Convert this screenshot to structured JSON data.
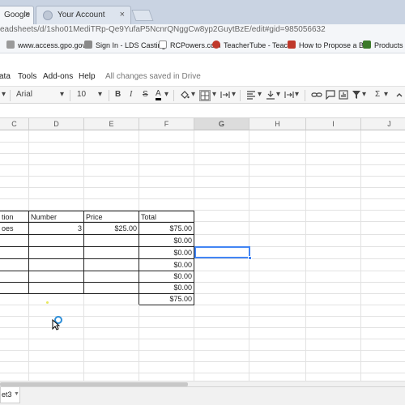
{
  "browser": {
    "tabs": [
      {
        "title": "Google",
        "close": "×"
      },
      {
        "title": "Your Account",
        "close": "×"
      }
    ],
    "url": "eadsheets/d/1sho01MediTRp-Qe9YufaP5NcnrQNggCw8yp2GuytBzE/edit#gid=985056632",
    "bookmarks": [
      {
        "label": "www.access.gpo.gov",
        "color": "#9a9a9a"
      },
      {
        "label": "Sign In - LDS Casting",
        "color": "#8a8a8a"
      },
      {
        "label": "RCPowers.com",
        "color": "#8e8e8e"
      },
      {
        "label": "TeacherTube - Teach",
        "color": "#c0392b"
      },
      {
        "label": "How to Propose a Bil",
        "color": "#c0392b"
      },
      {
        "label": "Products <",
        "color": "#3c7a2a"
      }
    ],
    "bookmark_overflow": "<<"
  },
  "menubar": {
    "items": [
      "ata",
      "Tools",
      "Add-ons",
      "Help"
    ],
    "status": "All changes saved in Drive"
  },
  "toolbar": {
    "font": "Arial",
    "font_size": "10",
    "bold": "B",
    "italic": "I",
    "strike": "S",
    "text_color": "A",
    "sigma": "Σ"
  },
  "grid": {
    "columns": [
      "C",
      "D",
      "E",
      "F",
      "G",
      "H",
      "I",
      "J"
    ],
    "selected_column": "G",
    "table": {
      "headers": [
        "tion",
        "Number",
        "Price",
        "Total"
      ],
      "rows": [
        [
          "oes",
          "3",
          "$25.00",
          "$75.00"
        ],
        [
          "",
          "",
          "",
          "$0.00"
        ],
        [
          "",
          "",
          "",
          "$0.00"
        ],
        [
          "",
          "",
          "",
          "$0.00"
        ],
        [
          "",
          "",
          "",
          "$0.00"
        ],
        [
          "",
          "",
          "",
          "$0.00"
        ]
      ],
      "grand_total": "$75.00"
    }
  },
  "sheets": {
    "active_tab": "et3"
  }
}
